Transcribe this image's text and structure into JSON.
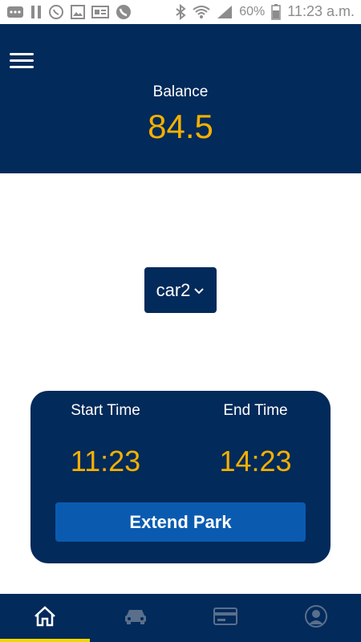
{
  "status_bar": {
    "icons_left": [
      "more-icon",
      "pause-icon",
      "whatsapp-icon",
      "image-icon",
      "ge-icon",
      "phone-icon"
    ],
    "icons_right": [
      "bluetooth-icon",
      "wifi-icon",
      "signal-icon",
      "battery-icon"
    ],
    "battery": "60%",
    "time": "11:23 a.m."
  },
  "header": {
    "menu_icon": "hamburger-menu-icon",
    "balance_label": "Balance",
    "balance_value": "84.5"
  },
  "car_selector": {
    "selected": "car2",
    "icon": "chevron-down-icon"
  },
  "park_card": {
    "start_label": "Start Time",
    "start_value": "11:23",
    "end_label": "End Time",
    "end_value": "14:23",
    "extend_label": "Extend Park"
  },
  "bottom_nav": {
    "items": [
      "home-icon",
      "car-icon",
      "card-icon",
      "profile-icon"
    ],
    "active_index": 0
  },
  "colors": {
    "primary": "#022a5a",
    "accent": "#f5b000",
    "button": "#0a5bb0",
    "indicator": "#f5d800"
  }
}
